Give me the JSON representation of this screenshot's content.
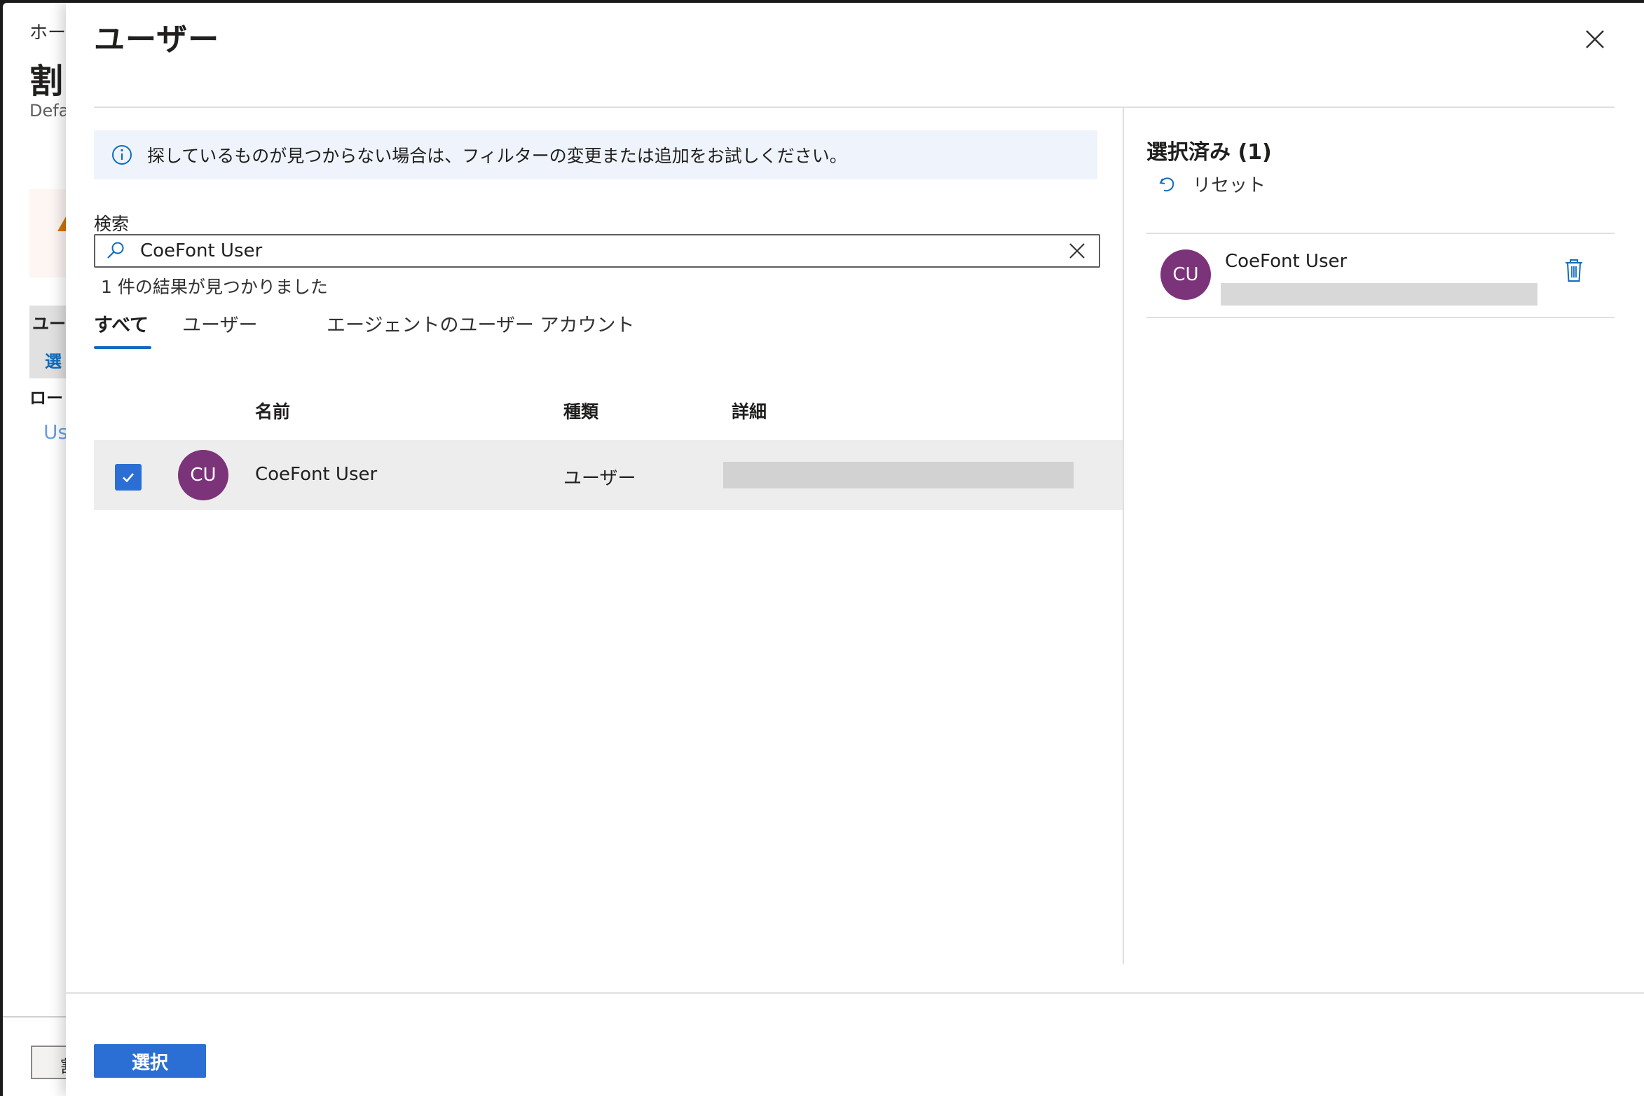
{
  "background": {
    "breadcrumb": "ホー",
    "title": "割",
    "subtitle": "Defa",
    "user_label": "ユー",
    "select_link": "選",
    "role_label": "ロー",
    "user_link": "Us",
    "footer_button": "割"
  },
  "panel": {
    "title": "ユーザー",
    "info_message": "探しているものが見つからない場合は、フィルターの変更または追加をお試しください。",
    "search": {
      "label": "検索",
      "value": "CoeFont User"
    },
    "result_count": "1 件の結果が見つかりました",
    "tabs": [
      {
        "label": "すべて",
        "active": true
      },
      {
        "label": "ユーザー",
        "active": false
      },
      {
        "label": "エージェントのユーザー アカウント",
        "active": false
      }
    ],
    "table": {
      "columns": {
        "name": "名前",
        "type": "種類",
        "details": "詳細"
      },
      "rows": [
        {
          "initials": "CU",
          "name": "CoeFont User",
          "type": "ユーザー",
          "checked": true
        }
      ]
    },
    "selected": {
      "title": "選択済み (1)",
      "reset_label": "リセット",
      "items": [
        {
          "initials": "CU",
          "name": "CoeFont User"
        }
      ]
    },
    "select_button": "選択"
  },
  "colors": {
    "accent": "#2b6fd4",
    "avatar": "#7b3379",
    "info_bg": "#eff4fc",
    "row_bg": "#ededed"
  }
}
